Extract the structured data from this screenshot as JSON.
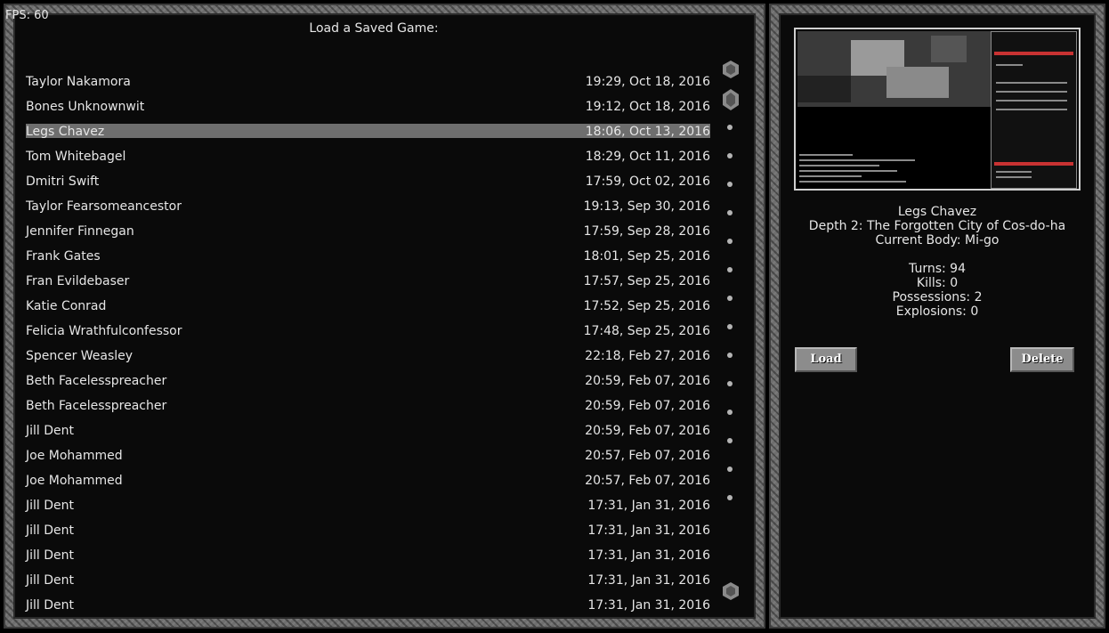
{
  "fps": "FPS: 60",
  "title": "Load a Saved Game:",
  "saves": [
    {
      "name": "Taylor Nakamora",
      "date": "19:29, Oct 18, 2016"
    },
    {
      "name": "Bones Unknownwit",
      "date": "19:12, Oct 18, 2016"
    },
    {
      "name": "Legs Chavez",
      "date": "18:06, Oct 13, 2016",
      "selected": true
    },
    {
      "name": "Tom Whitebagel",
      "date": "18:29, Oct 11, 2016"
    },
    {
      "name": "Dmitri Swift",
      "date": "17:59, Oct 02, 2016"
    },
    {
      "name": "Taylor Fearsomeancestor",
      "date": "19:13, Sep 30, 2016"
    },
    {
      "name": "Jennifer Finnegan",
      "date": "17:59, Sep 28, 2016"
    },
    {
      "name": "Frank Gates",
      "date": "18:01, Sep 25, 2016"
    },
    {
      "name": "Fran Evildebaser",
      "date": "17:57, Sep 25, 2016"
    },
    {
      "name": "Katie Conrad",
      "date": "17:52, Sep 25, 2016"
    },
    {
      "name": "Felicia Wrathfulconfessor",
      "date": "17:48, Sep 25, 2016"
    },
    {
      "name": "Spencer Weasley",
      "date": "22:18, Feb 27, 2016"
    },
    {
      "name": "Beth Facelesspreacher",
      "date": "20:59, Feb 07, 2016"
    },
    {
      "name": "Beth Facelesspreacher",
      "date": "20:59, Feb 07, 2016"
    },
    {
      "name": "Jill Dent",
      "date": "20:59, Feb 07, 2016"
    },
    {
      "name": "Joe Mohammed",
      "date": "20:57, Feb 07, 2016"
    },
    {
      "name": "Joe Mohammed",
      "date": "20:57, Feb 07, 2016"
    },
    {
      "name": "Jill Dent",
      "date": "17:31, Jan 31, 2016"
    },
    {
      "name": "Jill Dent",
      "date": "17:31, Jan 31, 2016"
    },
    {
      "name": "Jill Dent",
      "date": "17:31, Jan 31, 2016"
    },
    {
      "name": "Jill Dent",
      "date": "17:31, Jan 31, 2016"
    },
    {
      "name": "Jill Dent",
      "date": "17:31, Jan 31, 2016"
    }
  ],
  "details": {
    "name": "Legs Chavez",
    "depth": "Depth 2: The Forgotten City of Cos-do-ha",
    "body": "Current Body: Mi-go",
    "turns": "Turns: 94",
    "kills": "Kills: 0",
    "possessions": "Possessions: 2",
    "explosions": "Explosions: 0"
  },
  "buttons": {
    "load": "Load",
    "delete": "Delete"
  },
  "colors": {
    "selected_row": "#6e6e6e",
    "frame": "#6e6e6e",
    "button": "#8c8c8c"
  }
}
